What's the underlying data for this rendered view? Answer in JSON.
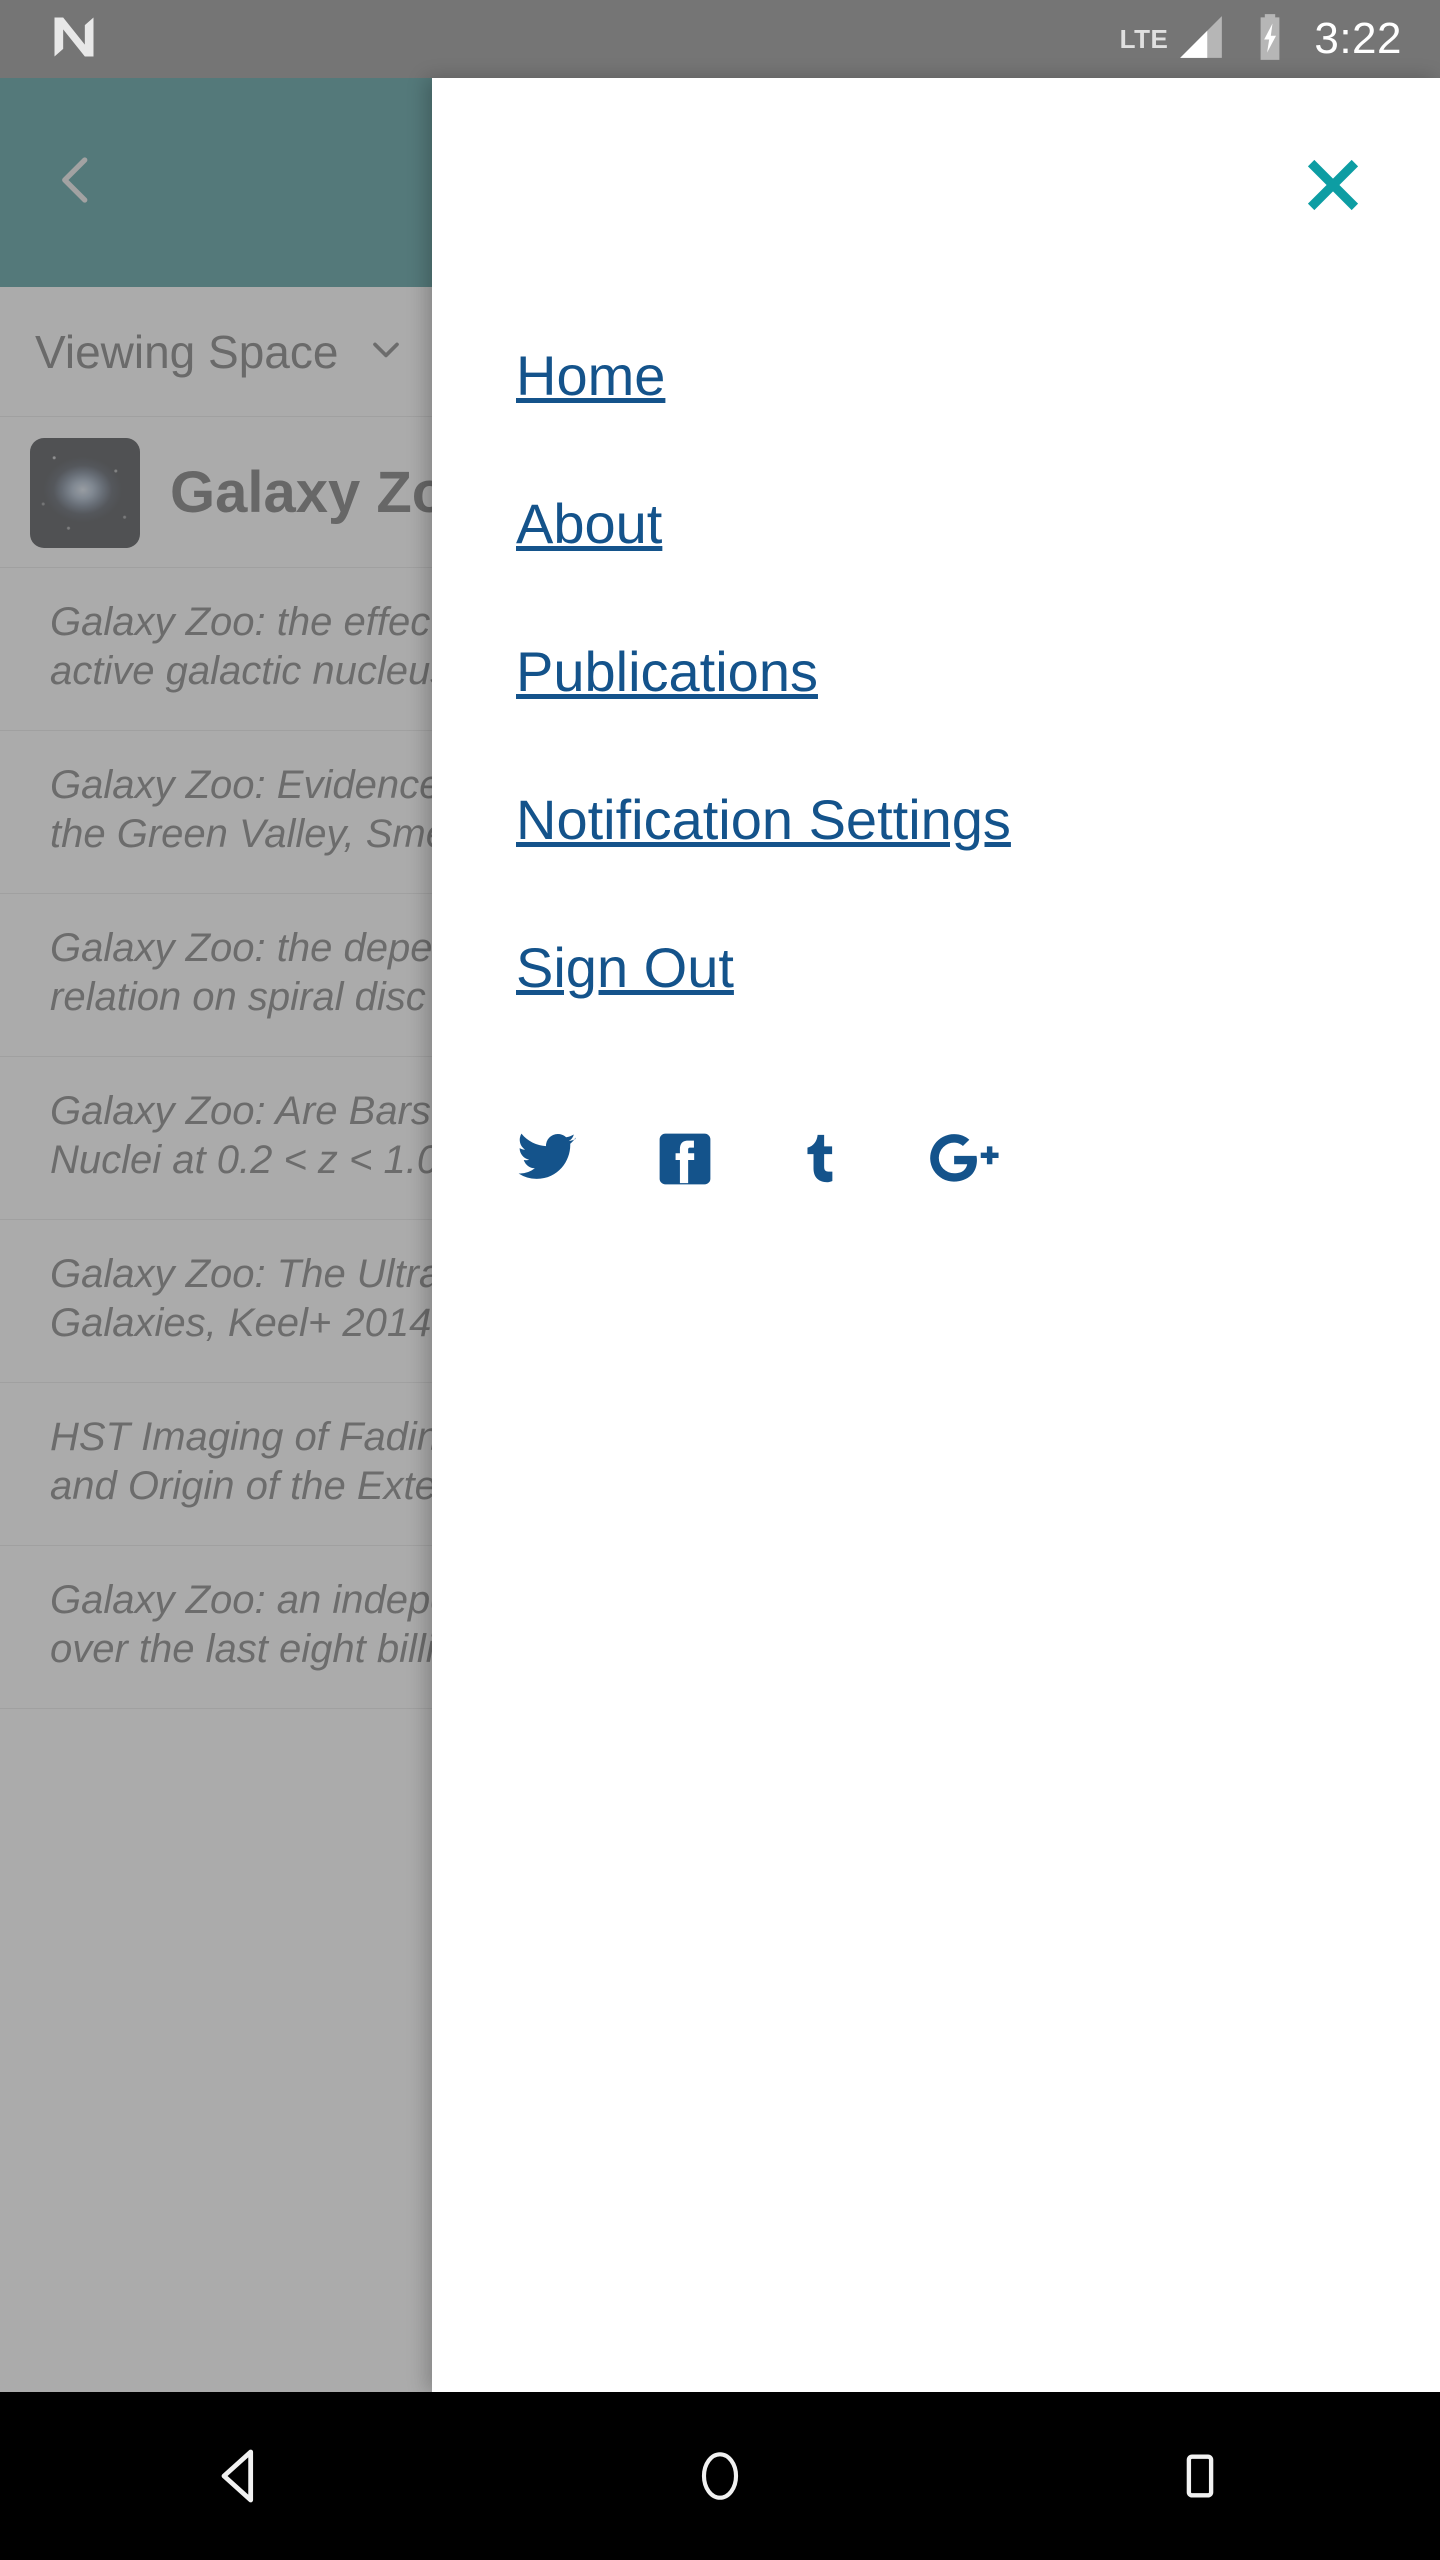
{
  "status_bar": {
    "notification_icon": "android-n-logo-icon",
    "network_label": "LTE",
    "signal_icon": "signal-bars-icon",
    "battery_icon": "battery-charging-icon",
    "time": "3:22",
    "background_color": "#757575",
    "text_color": "#ffffff"
  },
  "background_app": {
    "app_bar": {
      "back_icon": "chevron-left-icon",
      "background_color": "#1b7b7f"
    },
    "space_selector": {
      "label": "Viewing Space",
      "caret_icon": "chevron-down-icon"
    },
    "project": {
      "title": "Galaxy Zoo",
      "thumbnail_icon": "galaxy-thumbnail-image"
    },
    "publications": [
      {
        "text": "Galaxy Zoo: the effect of bar-driven fuelling on the\nactive galactic nucleus in disc galaxies"
      },
      {
        "text": "Galaxy Zoo: Evidence for Rapid, Recent Quenching within\nthe Green Valley, Smethurst+ 2015"
      },
      {
        "text": "Galaxy Zoo: the dependence of the star formation-stellar mass\nrelation on spiral disc morphology"
      },
      {
        "text": "Galaxy Zoo: Are Bars Responsible for Triggering Active Galactic\nNuclei at 0.2 < z < 1.0?"
      },
      {
        "text": "Galaxy Zoo: The Ultraviolet Colours of Fading Post-Starburst\nGalaxies, Keel+ 2014"
      },
      {
        "text": "HST Imaging of Fading AGN Candidates I: Host-Galaxy Properties\nand Origin of the Extended Gas"
      },
      {
        "text": "Galaxy Zoo: an independent look at the evolution of galaxies\nover the last eight billion years"
      }
    ]
  },
  "drawer": {
    "close_icon": "close-x-icon",
    "close_icon_color": "#0d9da3",
    "link_color": "#14538b",
    "menu": [
      {
        "label": "Home",
        "icon": "home-menu-item"
      },
      {
        "label": "About",
        "icon": "about-menu-item"
      },
      {
        "label": "Publications",
        "icon": "publications-menu-item"
      },
      {
        "label": "Notification Settings",
        "icon": "notification-settings-menu-item"
      },
      {
        "label": "Sign Out",
        "icon": "sign-out-menu-item"
      }
    ],
    "social": [
      {
        "name": "twitter-icon",
        "label": "Twitter"
      },
      {
        "name": "facebook-icon",
        "label": "Facebook"
      },
      {
        "name": "tumblr-icon",
        "label": "Tumblr"
      },
      {
        "name": "google-plus-icon",
        "label": "Google Plus"
      }
    ]
  },
  "nav_bar": {
    "back_icon": "android-back-icon",
    "home_icon": "android-home-icon",
    "recents_icon": "android-recents-icon",
    "background_color": "#000000"
  }
}
